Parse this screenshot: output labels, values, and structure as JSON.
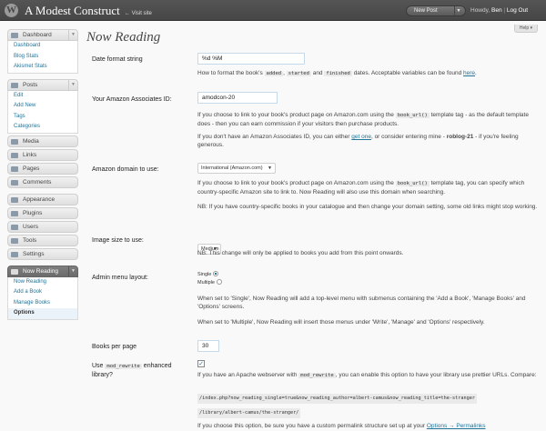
{
  "header": {
    "site_title": "A Modest Construct",
    "visit_site": "← Visit site",
    "new_post": "New Post",
    "howdy_prefix": "Howdy, ",
    "user_name": "Ben",
    "logout": "Log Out",
    "separator": "|"
  },
  "help": "Help ▾",
  "sidebar": {
    "dashboard": {
      "label": "Dashboard",
      "items": [
        "Dashboard",
        "Blog Stats",
        "Akismet Stats"
      ]
    },
    "posts": {
      "label": "Posts",
      "items": [
        "Edit",
        "Add New",
        "Tags",
        "Categories"
      ]
    },
    "media": "Media",
    "links": "Links",
    "pages": "Pages",
    "comments": "Comments",
    "appearance": "Appearance",
    "plugins": "Plugins",
    "users": "Users",
    "tools": "Tools",
    "settings": "Settings",
    "now_reading": {
      "label": "Now Reading",
      "items": [
        "Now Reading",
        "Add a Book",
        "Manage Books",
        "Options"
      ]
    }
  },
  "page": {
    "title": "Now Reading",
    "date_format": {
      "label": "Date format string",
      "value": "%d %M",
      "desc_1": "How to format the book's",
      "code_added": "added",
      "code_started": "started",
      "and": "and",
      "code_finished": "finished",
      "desc_2": "dates. Acceptable variables can be found",
      "link": "here",
      "period": "."
    },
    "amazon_id": {
      "label": "Your Amazon Associates ID:",
      "value": "amodcon-20",
      "desc_a1": "If you choose to link to your book's product page on Amazon.com using the",
      "code": "book_url()",
      "desc_a2": "template tag - as the default template does - then you can earn commission if your visitors then purchase products.",
      "desc_b1": "If you don't have an Amazon Associates ID, you can either",
      "link": "get one",
      "desc_b2": ", or consider entering mine -",
      "mine": "roblog-21",
      "desc_b3": "- if you're feeling generous."
    },
    "amazon_domain": {
      "label": "Amazon domain to use:",
      "value": "International (Amazon.com)",
      "desc_a1": "If you choose to link to your book's product page on Amazon.com using the",
      "code": "book_url()",
      "desc_a2": "template tag, you can specify which country-specific Amazon site to link to. Now Reading will also use this domain when searching.",
      "desc_b": "NB: If you have country-specific books in your catalogue and then change your domain setting, some old links might stop working."
    },
    "image_size": {
      "label": "Image size to use:",
      "value": "Medium",
      "desc": "NB: This change will only be applied to books you add from this point onwards."
    },
    "admin_menu": {
      "label": "Admin menu layout:",
      "option_single": "Single",
      "option_multiple": "Multiple",
      "selected": "Single",
      "desc_a": "When set to 'Single', Now Reading will add a top-level menu with submenus containing the 'Add a Book', 'Manage Books' and 'Options' screens.",
      "desc_b": "When set to 'Multiple', Now Reading will insert those menus under 'Write', 'Manage' and 'Options' respectively."
    },
    "books_per_page": {
      "label": "Books per page",
      "value": "30"
    },
    "mod_rewrite": {
      "label_1": "Use",
      "code": "mod_rewrite",
      "label_2": "enhanced",
      "label_3": "library?",
      "checked": true,
      "check_glyph": "✓",
      "desc_a1": "If you have an Apache webserver with",
      "desc_a2": ", you can enable this option to have your library use prettier URLs. Compare:",
      "url_1": "/index.php?now_reading_single=true&now_reading_author=albert-camus&now_reading_title=the-stranger",
      "url_2": "/library/albert-camus/the-stranger/",
      "desc_b1": "If you choose this option, be sure you have a custom permalink structure set up at your",
      "link": "Options → Permalinks"
    }
  }
}
